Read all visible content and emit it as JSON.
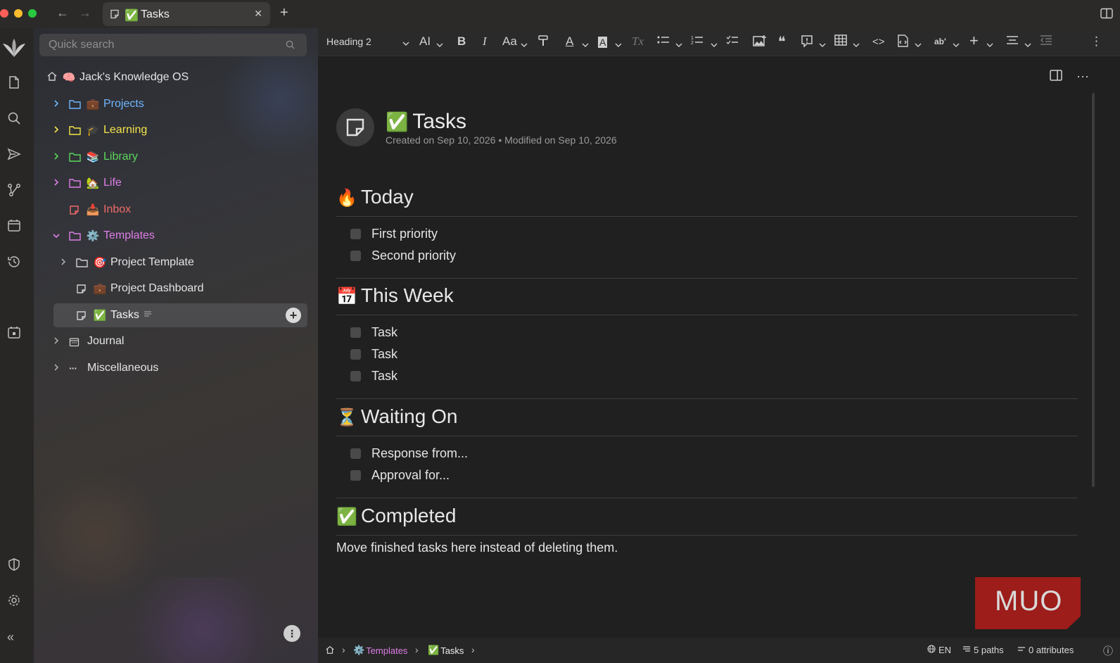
{
  "window": {
    "tab_title": "Tasks",
    "tab_emoji": "✅",
    "close_glyph": "✕",
    "new_tab_glyph": "+",
    "traffic_colors": [
      "#fe5f57",
      "#febc2e",
      "#28c840"
    ]
  },
  "search": {
    "placeholder": "Quick search"
  },
  "tree": {
    "root": {
      "label": "Jack's Knowledge OS",
      "emoji": "🧠"
    },
    "items": [
      {
        "label": "Projects",
        "emoji": "💼",
        "color": "#6fb6ff"
      },
      {
        "label": "Learning",
        "emoji": "🎓",
        "color": "#f3e44a"
      },
      {
        "label": "Library",
        "emoji": "📚",
        "color": "#5bd65b"
      },
      {
        "label": "Life",
        "emoji": "🏡",
        "color": "#de7ee8"
      },
      {
        "label": "Inbox",
        "emoji": "📥",
        "color": "#f06a6a"
      },
      {
        "label": "Templates",
        "emoji": "⚙️",
        "color": "#de7ee8"
      },
      {
        "label": "Project Template",
        "emoji": "🎯",
        "color": "#e4e4e4"
      },
      {
        "label": "Project Dashboard",
        "emoji": "💼",
        "color": "#e4e4e4"
      },
      {
        "label": "Tasks",
        "emoji": "✅",
        "color": "#f2f2f2"
      },
      {
        "label": "Journal",
        "emoji": "",
        "color": "#e4e4e4"
      },
      {
        "label": "Miscellaneous",
        "emoji": "",
        "color": "#e4e4e4"
      }
    ],
    "add_glyph": "+",
    "menu_glyph": "⋮"
  },
  "toolbar": {
    "heading_value": "Heading 2",
    "text_size_label": "AI",
    "bold_label": "B",
    "italic_label": "I",
    "case_label": "Aa",
    "text_color_label": "A",
    "highlight_label": "A",
    "clear_format_label": "Tx",
    "superscript_label": "ab'",
    "add_label": "+",
    "code_label": "<>",
    "quote_label": "❝",
    "more_label": "⋮"
  },
  "note": {
    "title": "Tasks",
    "title_emoji": "✅",
    "meta": "Created on Sep 10, 2026 • Modified on Sep 10, 2026",
    "more_label": "···",
    "sections": [
      {
        "emoji": "🔥",
        "title": "Today",
        "tasks": [
          "First priority",
          "Second priority"
        ]
      },
      {
        "emoji": "📅",
        "title": "This Week",
        "tasks": [
          "Task",
          "Task",
          "Task"
        ]
      },
      {
        "emoji": "⏳",
        "title": "Waiting On",
        "tasks": [
          "Response from...",
          "Approval for..."
        ]
      },
      {
        "emoji": "✅",
        "title": "Completed",
        "tasks": []
      }
    ],
    "completed_text": "Move finished tasks here instead of deleting them."
  },
  "watermark": {
    "text": "MUO",
    "color": "#9c1d1a"
  },
  "statusbar": {
    "crumbs": [
      {
        "label": "Templates",
        "emoji": "⚙️",
        "color": "#de7ee8"
      },
      {
        "label": "Tasks",
        "emoji": "✅",
        "color": "#f0f0f0"
      }
    ],
    "lang": "EN",
    "paths": "5 paths",
    "attributes": "0 attributes",
    "crumb_sep": "›",
    "info_glyph": "ⓘ"
  },
  "colors": {
    "sidebar_selected": "#4b4b4e",
    "editor_bg": "#202020"
  }
}
